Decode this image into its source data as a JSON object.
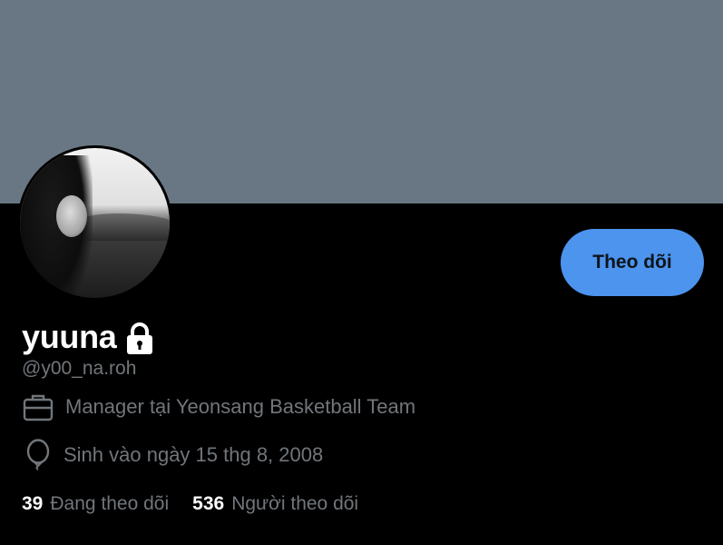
{
  "colors": {
    "banner": "#687783",
    "background": "#000000",
    "follow_button_bg": "#4c94ee",
    "follow_button_text": "#0f1419",
    "secondary_text": "#71767b"
  },
  "profile": {
    "display_name": "yuuna",
    "handle": "@y00_na.roh",
    "protected": true,
    "avatar": "profile-photo"
  },
  "actions": {
    "follow_label": "Theo dõi"
  },
  "info": {
    "job": {
      "icon": "briefcase-icon",
      "text": "Manager tại Yeonsang Basketball Team"
    },
    "birth": {
      "icon": "balloon-icon",
      "text": "Sinh vào ngày 15 thg 8, 2008"
    }
  },
  "stats": {
    "following_count": "39",
    "following_label": "Đang theo dõi",
    "followers_count": "536",
    "followers_label": "Người theo dõi"
  }
}
